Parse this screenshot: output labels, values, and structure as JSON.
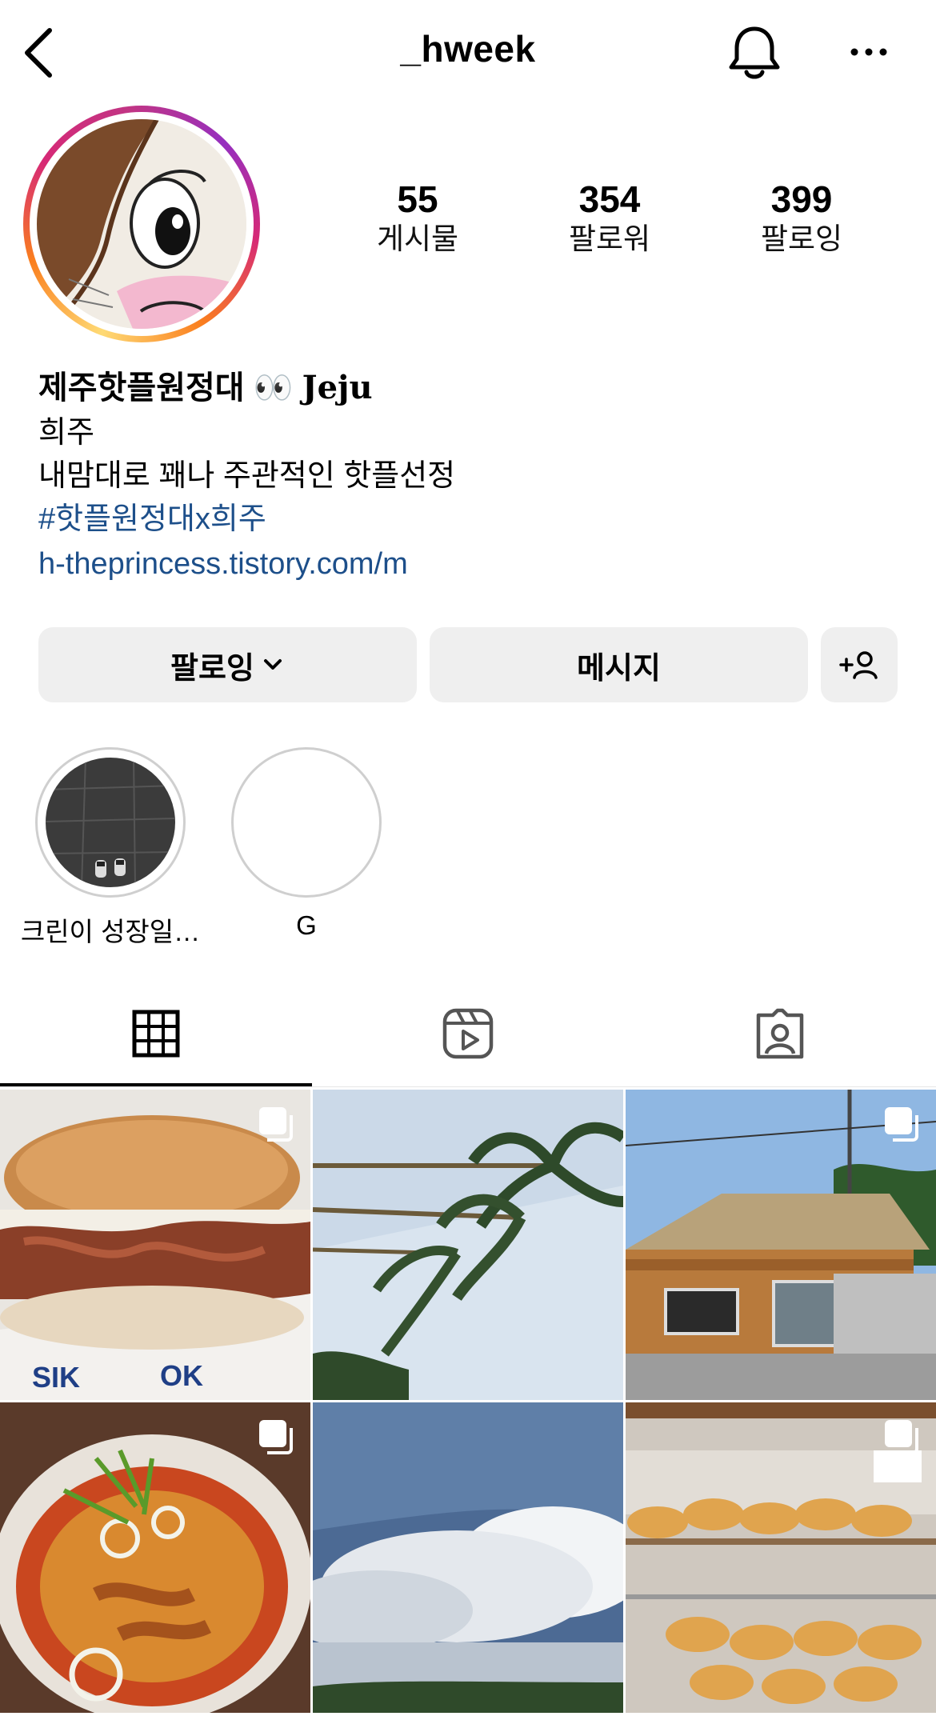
{
  "header": {
    "username": "_hweek",
    "back_icon": "chevron-left-icon",
    "bell_icon": "bell-icon",
    "more_icon": "more-horizontal-icon"
  },
  "stats": [
    {
      "value": "55",
      "label": "게시물"
    },
    {
      "value": "354",
      "label": "팔로워"
    },
    {
      "value": "399",
      "label": "팔로잉"
    }
  ],
  "bio": {
    "name": "제주핫플원정대",
    "name_emoji": "👀",
    "name_suffix": "Jeju",
    "line1": "희주",
    "line2": "내맘대로 꽤나 주관적인 핫플선정",
    "hashtag": "#핫플원정대x희주",
    "url": "h-theprincess.tistory.com/m"
  },
  "buttons": {
    "following": "팔로잉",
    "message": "메시지",
    "add_user_icon": "add-person-icon"
  },
  "highlights": [
    {
      "label": "크린이 성장일…"
    },
    {
      "label": "G"
    }
  ],
  "tabs": [
    {
      "icon": "grid-icon",
      "active": true
    },
    {
      "icon": "reels-icon",
      "active": false
    },
    {
      "icon": "tagged-icon",
      "active": false
    }
  ],
  "colors": {
    "link": "#1d4f8a",
    "button_bg": "#efefef",
    "story_ring_start": "#feda75",
    "story_ring_end": "#c13584"
  }
}
